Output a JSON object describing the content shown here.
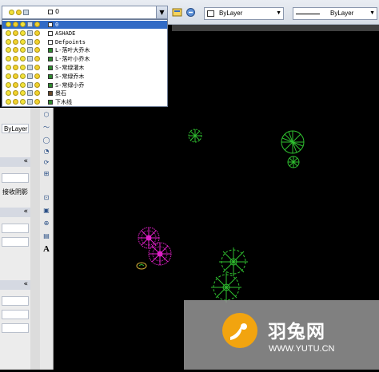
{
  "toolbar": {
    "current_layer": "0",
    "color_combo": "ByLayer",
    "linetype_combo": "ByLayer",
    "combo_arrow": "▼"
  },
  "layer_list": [
    {
      "name": "0",
      "color": "#ffffff",
      "selected": true
    },
    {
      "name": "ASHADE",
      "color": "#ffffff",
      "selected": false
    },
    {
      "name": "Defpoints",
      "color": "#ffffff",
      "selected": false
    },
    {
      "name": "L-落叶大乔木",
      "color": "#2e8b2e",
      "selected": false
    },
    {
      "name": "L-落叶小乔木",
      "color": "#2e8b2e",
      "selected": false
    },
    {
      "name": "S-常绿灌木",
      "color": "#2e8b2e",
      "selected": false
    },
    {
      "name": "S-常绿乔木",
      "color": "#2e8b2e",
      "selected": false
    },
    {
      "name": "S-常绿小乔",
      "color": "#2e8b2e",
      "selected": false
    },
    {
      "name": "景石",
      "color": "#6b4a2a",
      "selected": false
    },
    {
      "name": "下木线",
      "color": "#2e8b2e",
      "selected": false
    }
  ],
  "left_panel": {
    "bylayer_label": "ByLayer",
    "shadow_label": "接收阴影",
    "collapse_glyph": "«"
  },
  "tools": [
    "⬡",
    "〜",
    "◯",
    "◔",
    "⟳",
    "⊞",
    "⊡",
    "▣",
    "⊕",
    "▤",
    "A"
  ],
  "watermark": {
    "title": "羽兔网",
    "url": "WWW.YUTU.CN"
  },
  "colors": {
    "plant_green": "#2fbf2f",
    "flower_magenta": "#e020c8",
    "accent_selection": "#316ac5"
  }
}
